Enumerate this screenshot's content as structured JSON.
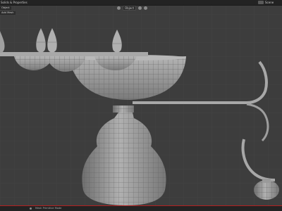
{
  "header": {
    "title": "Solids & Properties",
    "mode": "Object",
    "right_label": "Scene"
  },
  "left_panel": {
    "items": [
      "Object",
      "Add Mesh"
    ]
  },
  "status": {
    "text": "Mesh Primitive Mode"
  },
  "colors": {
    "background": "#3d3d3d",
    "grid": "#474747",
    "mesh_fill": "#9a9a9a",
    "wire": "#5c5c5c",
    "accent": "#b32020"
  }
}
